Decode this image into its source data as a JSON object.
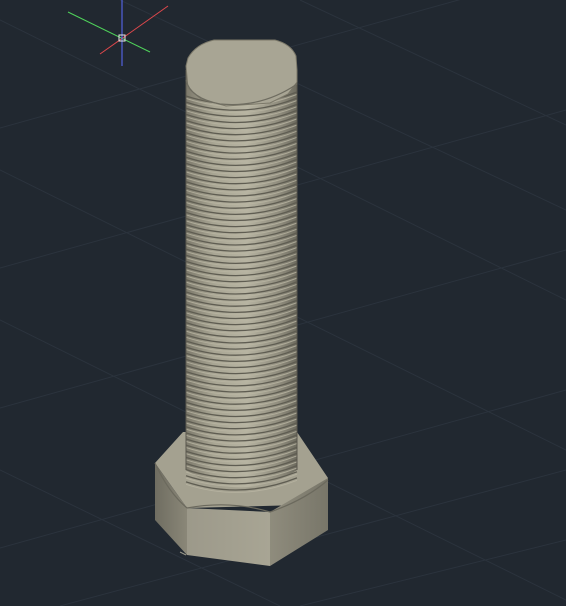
{
  "viewport": {
    "background_color": "#212830",
    "grid_color": "#2b333d",
    "grid_visible": true,
    "visual_style": "realistic",
    "projection": "isometric"
  },
  "ucs_icon": {
    "x_axis_color": "#e0484c",
    "y_axis_color": "#4fd35a",
    "z_axis_color": "#5a6cff",
    "cursor_color": "#e8e8e8"
  },
  "model": {
    "object": "hex-head-bolt",
    "thread_turns_visible": 64,
    "material_light_color": "#b9b5a3",
    "material_mid_color": "#8f8c7c",
    "material_dark_color": "#5f5d52"
  }
}
